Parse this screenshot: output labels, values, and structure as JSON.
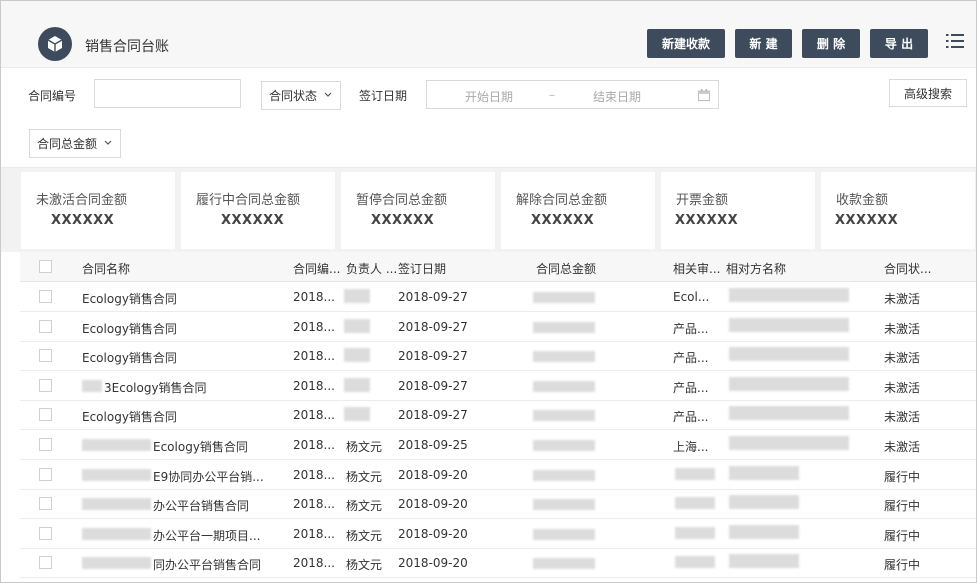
{
  "header": {
    "title": "销售合同台账",
    "buttons": {
      "new_receipt": "新建收款",
      "new": "新 建",
      "delete": "删 除",
      "export": "导 出"
    }
  },
  "filters": {
    "contract_no_label": "合同编号",
    "contract_no_value": "",
    "status_select": "合同状态",
    "sign_date_label": "签订日期",
    "start_placeholder": "开始日期",
    "range_sep": "–",
    "end_placeholder": "结束日期",
    "advanced_search": "高级搜索",
    "amount_select": "合同总金额"
  },
  "summary": [
    {
      "title": "未激活合同金额",
      "value": "XXXXXX"
    },
    {
      "title": "履行中合同总金额",
      "value": "XXXXXX"
    },
    {
      "title": "暂停合同总金额",
      "value": "XXXXXX"
    },
    {
      "title": "解除合同总金额",
      "value": "XXXXXX"
    },
    {
      "title": "开票金额",
      "value": "XXXXXX"
    },
    {
      "title": "收款金额",
      "value": "XXXXXX"
    }
  ],
  "table": {
    "columns": [
      "合同名称",
      "合同编...",
      "负责人 ...",
      "签订日期",
      "合同总金额",
      "相关审...",
      "相对方名称",
      "合同状..."
    ],
    "rows": [
      {
        "name": "Ecology销售合同",
        "no": "2018...",
        "owner": "",
        "date": "2018-09-27",
        "rel": "Ecol...",
        "status": "未激活"
      },
      {
        "name": "Ecology销售合同",
        "no": "2018...",
        "owner": "",
        "date": "2018-09-27",
        "rel": "产品...",
        "status": "未激活"
      },
      {
        "name": "Ecology销售合同",
        "no": "2018...",
        "owner": "",
        "date": "2018-09-27",
        "rel": "产品...",
        "status": "未激活"
      },
      {
        "name": "3Ecology销售合同",
        "no": "2018...",
        "owner": "",
        "date": "2018-09-27",
        "rel": "产品...",
        "status": "未激活"
      },
      {
        "name": "Ecology销售合同",
        "no": "2018...",
        "owner": "",
        "date": "2018-09-27",
        "rel": "产品...",
        "status": "未激活"
      },
      {
        "name": "Ecology销售合同",
        "no": "2018...",
        "owner": "杨文元",
        "date": "2018-09-25",
        "rel": "上海...",
        "status": "未激活"
      },
      {
        "name": "E9协同办公平台销...",
        "no": "2018...",
        "owner": "杨文元",
        "date": "2018-09-20",
        "rel": "",
        "status": "履行中"
      },
      {
        "name": "办公平台销售合同",
        "no": "2018...",
        "owner": "杨文元",
        "date": "2018-09-20",
        "rel": "",
        "status": "履行中"
      },
      {
        "name": "办公平台一期项目...",
        "no": "2018...",
        "owner": "杨文元",
        "date": "2018-09-20",
        "rel": "",
        "status": "履行中"
      },
      {
        "name": "同办公平台销售合同",
        "no": "2018...",
        "owner": "杨文元",
        "date": "2018-09-20",
        "rel": "",
        "status": "履行中"
      }
    ]
  },
  "colors": {
    "primary": "#3d4b5c",
    "header_bg": "#f7f7f7",
    "border": "#d9d9d9"
  },
  "icons": [
    "cube-icon",
    "list-menu-icon",
    "chevron-down-icon",
    "calendar-icon",
    "checkbox-icon"
  ]
}
